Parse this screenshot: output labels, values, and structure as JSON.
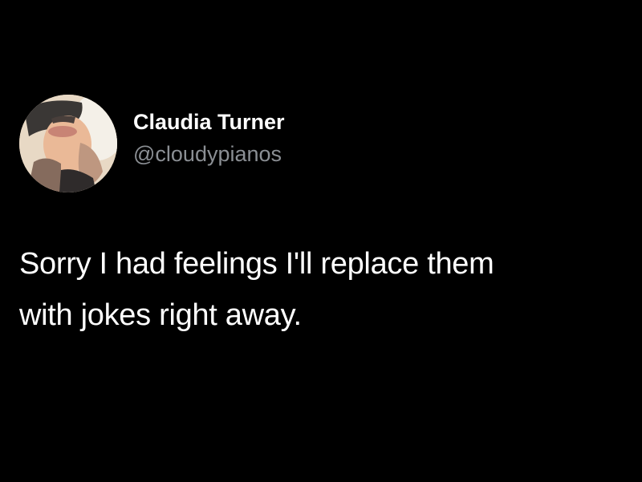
{
  "tweet": {
    "author": {
      "display_name": "Claudia Turner",
      "handle": "@cloudypianos",
      "avatar_icon": "profile-photo"
    },
    "lines": [
      "Sorry I had feelings I'll replace them",
      "with jokes right away."
    ]
  },
  "colors": {
    "background": "#000000",
    "text": "#ffffff",
    "handle": "#8b8f94"
  }
}
